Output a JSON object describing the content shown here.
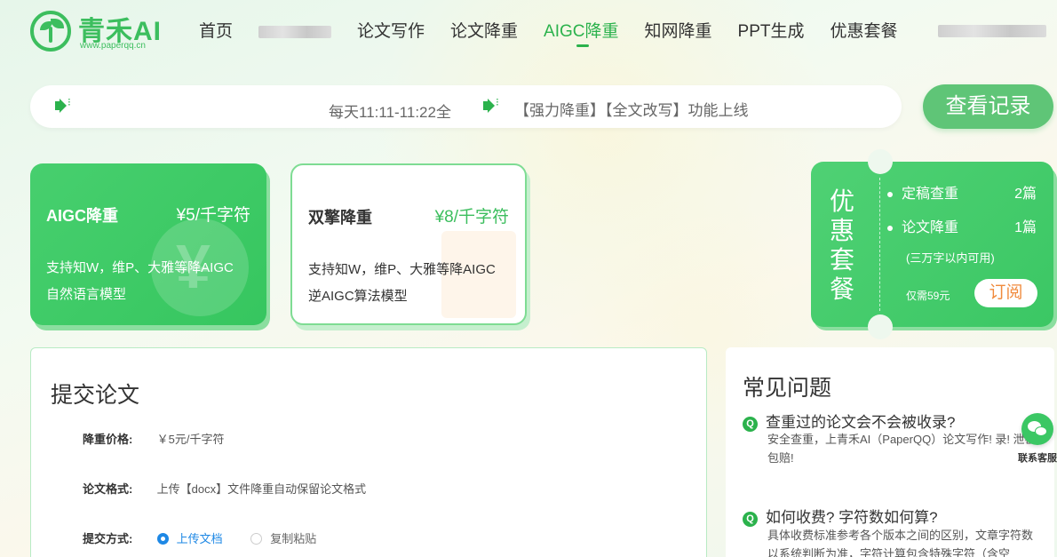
{
  "header": {
    "logo_title": "青禾AI",
    "logo_sub": "www.paperqq.cn",
    "nav": [
      {
        "label": "首页"
      },
      {
        "label": "论文写作"
      },
      {
        "label": "论文降重"
      },
      {
        "label": "AIGC降重"
      },
      {
        "label": "知网降重"
      },
      {
        "label": "PPT生成"
      },
      {
        "label": "优惠套餐"
      }
    ],
    "active_nav": "AIGC降重"
  },
  "notice": {
    "text1": "每天11:11-11:22全",
    "text2": "【强力降重】【全文改写】功能上线"
  },
  "history_button": "查看记录",
  "cards": [
    {
      "title": "AIGC降重",
      "price": "¥5/千字符",
      "desc1": "支持知W，维P、大雅等降AIGC",
      "desc2": "自然语言模型"
    },
    {
      "title": "双擎降重",
      "price": "¥8/千字符",
      "desc1": "支持知W，维P、大雅等降AIGC",
      "desc2": "逆AIGC算法模型"
    }
  ],
  "promo": {
    "title": "优惠套餐",
    "items": [
      {
        "label": "定稿查重",
        "value": "2篇"
      },
      {
        "label": "论文降重",
        "value": "1篇"
      }
    ],
    "note": "(三万字以内可用)",
    "price": "仅需59元",
    "subscribe": "订阅"
  },
  "submit_panel": {
    "title": "提交论文",
    "price_label": "降重价格:",
    "price_value": "￥5元/千字符",
    "format_label": "论文格式:",
    "format_value": "上传【docx】文件降重自动保留论文格式",
    "method_label": "提交方式:",
    "method_upload": "上传文档",
    "method_paste": "复制粘贴",
    "selected_method": "上传文档"
  },
  "faq": {
    "title": "常见问题",
    "items": [
      {
        "q": "查重过的论文会不会被收录?",
        "a": "安全查重，上青禾AI（PaperQQ）论文写作! 录! 泄密包赔!"
      },
      {
        "q": "如何收费? 字符数如何算?",
        "a": "具体收费标准参考各个版本之间的区别，文章字符数以系统判断为准，字符计算包含特殊字符（含空"
      }
    ]
  },
  "service": {
    "label": "联系客服"
  },
  "colors": {
    "brand_green": "#3cbe5e",
    "accent_blue": "#1e88e5",
    "subscribe_orange": "#f08a3c"
  }
}
